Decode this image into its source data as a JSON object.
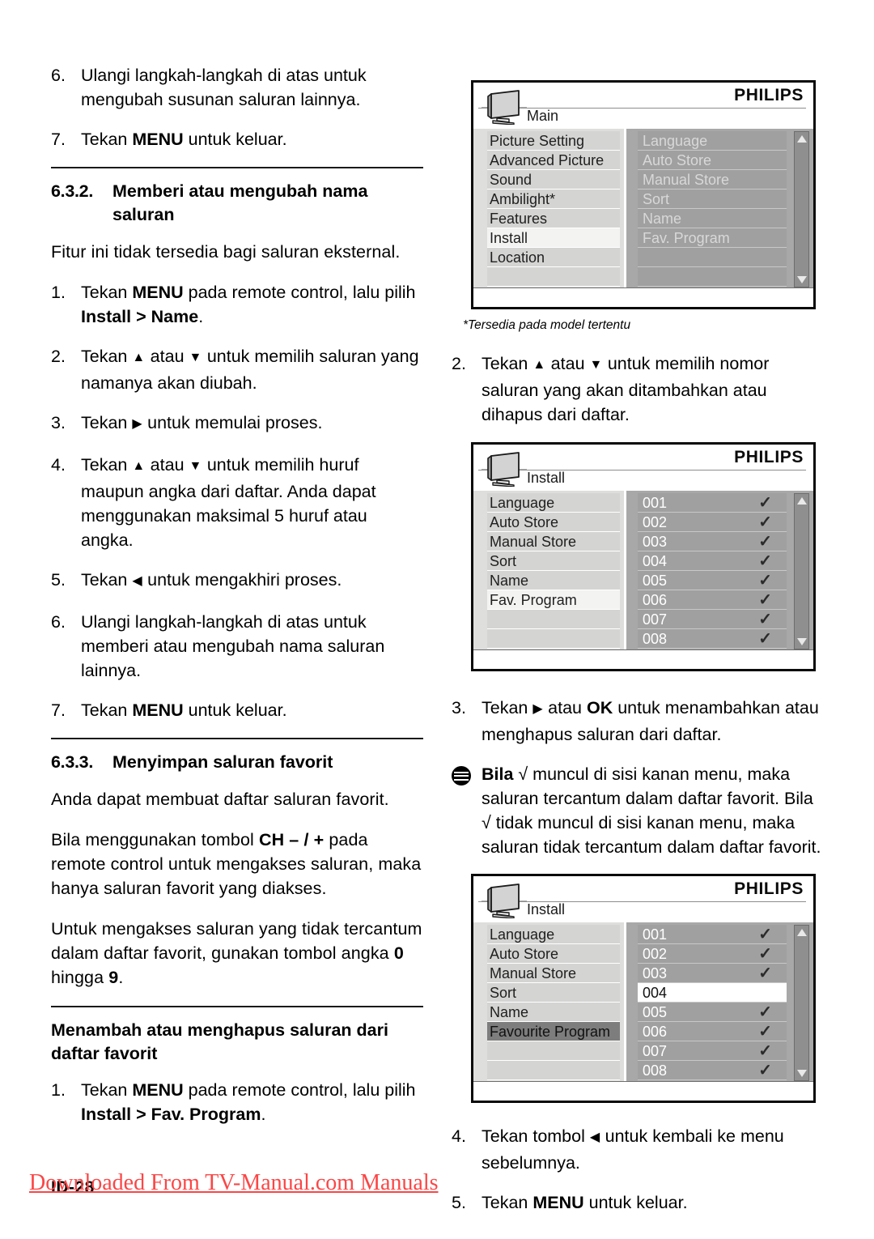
{
  "document": {
    "page_number": "ID-28",
    "watermark": "Downloaded From TV-Manual.com Manuals"
  },
  "left_column": {
    "item_6a": {
      "num": "6.",
      "text": "Ulangi langkah-langkah di atas untuk mengubah susunan saluran lainnya."
    },
    "item_7a": {
      "num": "7.",
      "pre": "Tekan ",
      "bold": "MENU",
      "post": " untuk keluar."
    },
    "section_632": {
      "number": "6.3.2.",
      "title": "Memberi atau mengubah nama saluran"
    },
    "intro_632": "Fitur ini tidak tersedia bagi saluran eksternal.",
    "step_1": {
      "num": "1.",
      "p1": "Tekan ",
      "b1": "MENU",
      "p2": " pada remote control, lalu pilih ",
      "b2": "Install",
      "p3": " > ",
      "b3": "Name",
      "p4": "."
    },
    "step_2": {
      "num": "2.",
      "p1": "Tekan ",
      "up": "▲",
      "p2": " atau ",
      "down": "▼",
      "p3": " untuk memilih saluran yang namanya akan diubah."
    },
    "step_3": {
      "num": "3.",
      "p1": "Tekan ",
      "right": "▶",
      "p2": " untuk memulai proses."
    },
    "step_4": {
      "num": "4.",
      "p1": "Tekan ",
      "up": "▲",
      "p2": " atau ",
      "down": "▼",
      "p3": " untuk memilih huruf maupun angka dari daftar. Anda dapat menggunakan maksimal 5 huruf atau angka."
    },
    "step_5": {
      "num": "5.",
      "p1": "Tekan ",
      "left": "◀",
      "p2": " untuk mengakhiri proses."
    },
    "step_6": {
      "num": "6.",
      "text": "Ulangi langkah-langkah di atas untuk memberi atau mengubah nama saluran lainnya."
    },
    "step_7": {
      "num": "7.",
      "pre": "Tekan ",
      "bold": "MENU",
      "post": " untuk keluar."
    },
    "section_633": {
      "number": "6.3.3.",
      "title": "Menyimpan saluran favorit"
    },
    "para_633_1": "Anda dapat membuat daftar saluran favorit.",
    "para_633_2": {
      "p1": "Bila menggunakan tombol ",
      "b1": "CH – / +",
      "p2": " pada remote control untuk mengakses saluran, maka hanya saluran favorit yang diakses."
    },
    "para_633_3": {
      "p1": "Untuk mengakses saluran yang tidak tercantum dalam daftar favorit, gunakan tombol angka ",
      "b1": "0",
      "p2": " hingga ",
      "b2": "9",
      "p3": "."
    },
    "heading_fav": "Menambah atau menghapus saluran dari daftar favorit",
    "fav_step_1": {
      "num": "1.",
      "p1": "Tekan ",
      "b1": "MENU",
      "p2": " pada remote control, lalu pilih ",
      "b2": "Install",
      "p3": " > ",
      "b3": "Fav. Program",
      "p4": "."
    }
  },
  "right_column": {
    "menu_main": {
      "logo": "PHILIPS",
      "title": "Main",
      "icon": "tv-icon",
      "left_items": [
        {
          "label": "Picture Setting",
          "selected": false
        },
        {
          "label": "Advanced Picture",
          "selected": false
        },
        {
          "label": "Sound",
          "selected": false
        },
        {
          "label": "Ambilight*",
          "selected": false
        },
        {
          "label": "Features",
          "selected": false
        },
        {
          "label": "Install",
          "selected": true
        },
        {
          "label": "Location",
          "selected": false
        },
        {
          "label": "",
          "selected": false
        }
      ],
      "right_items": [
        {
          "label": "Language"
        },
        {
          "label": "Auto Store"
        },
        {
          "label": "Manual Store"
        },
        {
          "label": "Sort"
        },
        {
          "label": "Name"
        },
        {
          "label": "Fav. Program"
        },
        {
          "label": ""
        },
        {
          "label": ""
        }
      ]
    },
    "caption_1": "*Tersedia pada model tertentu",
    "step_2": {
      "num": "2.",
      "p1": "Tekan ",
      "up": "▲",
      "p2": " atau ",
      "down": "▼",
      "p3": " untuk memilih nomor saluran yang akan ditambahkan atau dihapus dari daftar."
    },
    "menu_install_1": {
      "logo": "PHILIPS",
      "title": "Install",
      "icon": "tv-icon",
      "left_items": [
        {
          "label": "Language",
          "selected": false
        },
        {
          "label": "Auto Store",
          "selected": false
        },
        {
          "label": "Manual Store",
          "selected": false
        },
        {
          "label": "Sort",
          "selected": false
        },
        {
          "label": "Name",
          "selected": false
        },
        {
          "label": "Fav. Program",
          "selected": true
        },
        {
          "label": "",
          "selected": false
        },
        {
          "label": "",
          "selected": false
        }
      ],
      "channels": [
        {
          "number": "001",
          "check": "✓",
          "highlighted": false
        },
        {
          "number": "002",
          "check": "✓",
          "highlighted": false
        },
        {
          "number": "003",
          "check": "✓",
          "highlighted": false
        },
        {
          "number": "004",
          "check": "✓",
          "highlighted": false
        },
        {
          "number": "005",
          "check": "✓",
          "highlighted": false
        },
        {
          "number": "006",
          "check": "✓",
          "highlighted": false
        },
        {
          "number": "007",
          "check": "✓",
          "highlighted": false
        },
        {
          "number": "008",
          "check": "✓",
          "highlighted": false
        }
      ]
    },
    "step_3": {
      "num": "3.",
      "p1": "Tekan ",
      "right": "▶",
      "p2": " atau ",
      "b1": "OK",
      "p3": " untuk menambahkan atau menghapus saluran dari daftar."
    },
    "note": {
      "b1": "Bila",
      "p1": " √ muncul di sisi kanan menu, maka saluran tercantum dalam daftar favorit. Bila √ tidak muncul di sisi kanan menu, maka saluran tidak tercantum dalam daftar favorit."
    },
    "menu_install_2": {
      "logo": "PHILIPS",
      "title": "Install",
      "icon": "tv-icon",
      "left_items": [
        {
          "label": "Language",
          "selected": false
        },
        {
          "label": "Auto Store",
          "selected": false
        },
        {
          "label": "Manual Store",
          "selected": false
        },
        {
          "label": "Sort",
          "selected": false
        },
        {
          "label": "Name",
          "selected": false
        },
        {
          "label": "Favourite Program",
          "selected": true
        },
        {
          "label": "",
          "selected": false
        },
        {
          "label": "",
          "selected": false
        }
      ],
      "channels": [
        {
          "number": "001",
          "check": "✓",
          "highlighted": false
        },
        {
          "number": "002",
          "check": "✓",
          "highlighted": false
        },
        {
          "number": "003",
          "check": "✓",
          "highlighted": false
        },
        {
          "number": "004",
          "check": "",
          "highlighted": true
        },
        {
          "number": "005",
          "check": "✓",
          "highlighted": false
        },
        {
          "number": "006",
          "check": "✓",
          "highlighted": false
        },
        {
          "number": "007",
          "check": "✓",
          "highlighted": false
        },
        {
          "number": "008",
          "check": "✓",
          "highlighted": false
        }
      ]
    },
    "step_4": {
      "num": "4.",
      "p1": "Tekan tombol ",
      "left": "◀",
      "p2": " untuk kembali ke menu sebelumnya."
    },
    "step_5": {
      "num": "5.",
      "p1": "Tekan ",
      "b1": "MENU",
      "p2": " untuk keluar."
    }
  },
  "colors": {
    "osd_border": "#0a0a0a",
    "osd_left_panel": "#dededd",
    "osd_right_panel": "#a8a8a8",
    "row_left": "#d4d4d3",
    "row_left_selected": "#f3f3f2",
    "row_left_selected_dark": "#7d7d7d",
    "row_right": "#a0a0a0",
    "row_right_selected": "#ffffff",
    "watermark_red": "#fb4646"
  }
}
